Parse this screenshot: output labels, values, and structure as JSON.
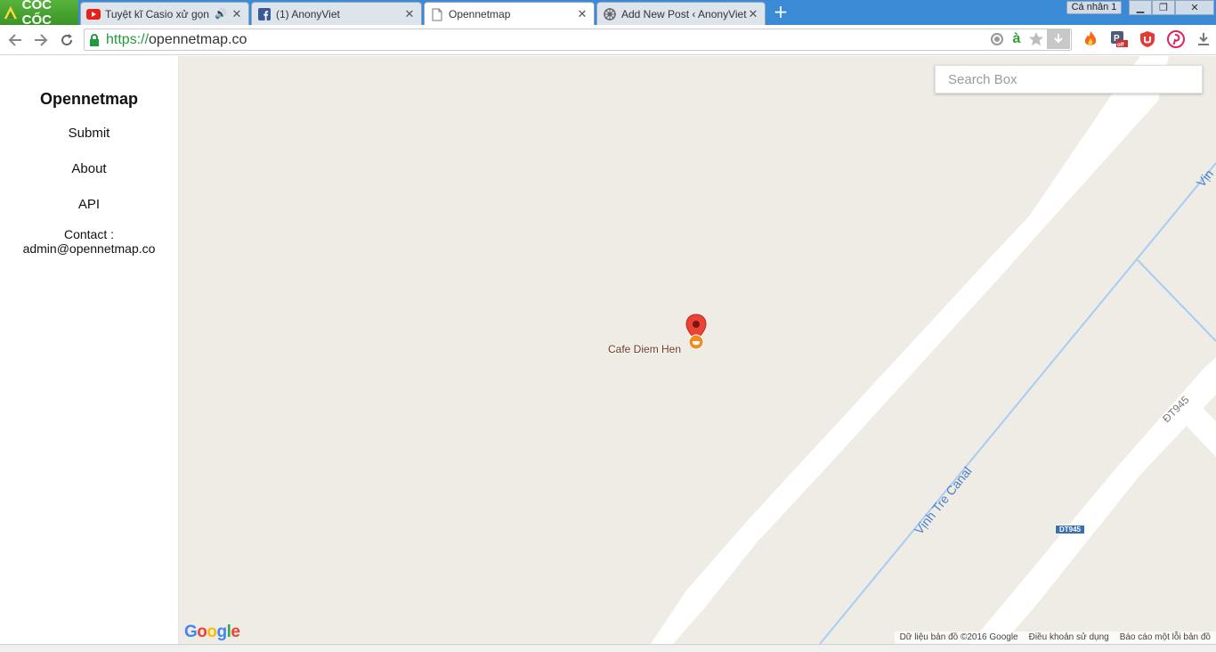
{
  "browser": {
    "brand": "CỐC CỐC",
    "tabs": [
      {
        "title": "Tuyệt kĩ Casio xử gọn Đ",
        "icon": "youtube-icon"
      },
      {
        "title": "(1) AnonyViet",
        "icon": "facebook-icon"
      },
      {
        "title": "Opennetmap",
        "icon": "page-icon"
      },
      {
        "title": "Add New Post ‹ AnonyViet",
        "icon": "wordpress-icon"
      }
    ],
    "profile": "Cá nhân 1",
    "url_scheme": "https://",
    "url_host": "opennetmap.co"
  },
  "sidebar": {
    "title": "Opennetmap",
    "links": [
      "Submit",
      "About",
      "API"
    ],
    "contact_label": "Contact :",
    "contact_email": "admin@opennetmap.co"
  },
  "map": {
    "search_placeholder": "Search Box",
    "poi_name": "Cafe Diem Hen",
    "canal_label": "Vịnh Tre Canal",
    "canal_label_edge": "Vịn",
    "road_label": "ĐT945",
    "road_shield": "DT945",
    "google_logo": [
      "G",
      "o",
      "o",
      "g",
      "l",
      "e"
    ],
    "attribution": [
      "Dữ liệu bản đồ ©2016 Google",
      "Điều khoản sử dụng",
      "Báo cáo một lỗi bản đồ"
    ],
    "colors": {
      "land": "#efece6",
      "road": "#ffffff",
      "water": "#a7cdf2",
      "pin": "#ea4335",
      "poi": "#f28a1f"
    }
  }
}
